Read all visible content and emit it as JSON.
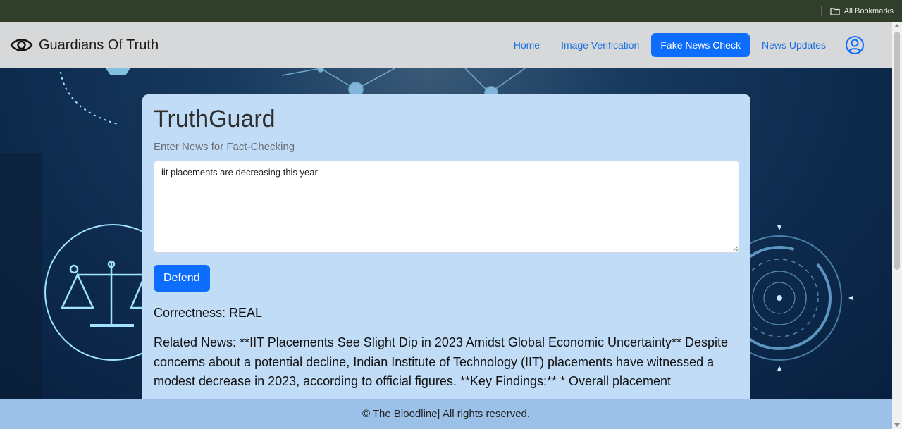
{
  "browser": {
    "bookmarks_label": "All Bookmarks"
  },
  "navbar": {
    "brand_title": "Guardians Of Truth",
    "links": [
      {
        "label": "Home",
        "active": false
      },
      {
        "label": "Image Verification",
        "active": false
      },
      {
        "label": "Fake News Check",
        "active": true
      },
      {
        "label": "News Updates",
        "active": false
      }
    ],
    "icons": {
      "brand": "eye-icon",
      "profile": "user-circle-icon"
    }
  },
  "card": {
    "title": "TruthGuard",
    "subtitle": "Enter News for Fact-Checking",
    "input_value": "iit placements are decreasing this year",
    "button_label": "Defend",
    "result": "Correctness: REAL",
    "related_news": "Related News: **IIT Placements See Slight Dip in 2023 Amidst Global Economic Uncertainty** Despite concerns about a potential decline, Indian Institute of Technology (IIT) placements have witnessed a modest decrease in 2023, according to official figures. **Key Findings:** * Overall placement"
  },
  "footer": {
    "text": "© The Bloodline| All rights reserved."
  },
  "colors": {
    "accent": "#0d6efd",
    "navbar_bg": "#d6d8da",
    "card_bg": "#c0dcf6",
    "footer_bg": "#9cc1e8",
    "bookmarks_bar_bg": "#323e2c"
  }
}
